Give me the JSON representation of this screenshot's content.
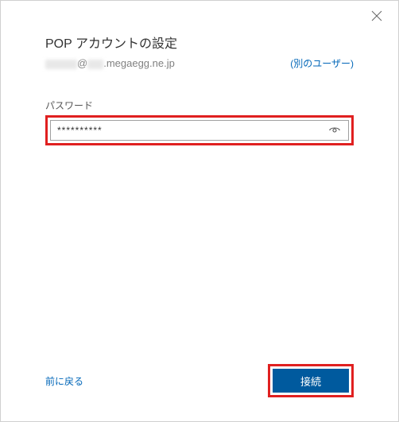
{
  "dialog": {
    "title": "POP アカウントの設定",
    "email_domain": ".megaegg.ne.jp",
    "email_at": "@",
    "switch_user_label": "(別のユーザー)",
    "password_label": "パスワード",
    "password_value": "**********",
    "back_label": "前に戻る",
    "connect_label": "接続"
  },
  "icons": {
    "close": "close-icon",
    "eye": "reveal-password-icon"
  }
}
